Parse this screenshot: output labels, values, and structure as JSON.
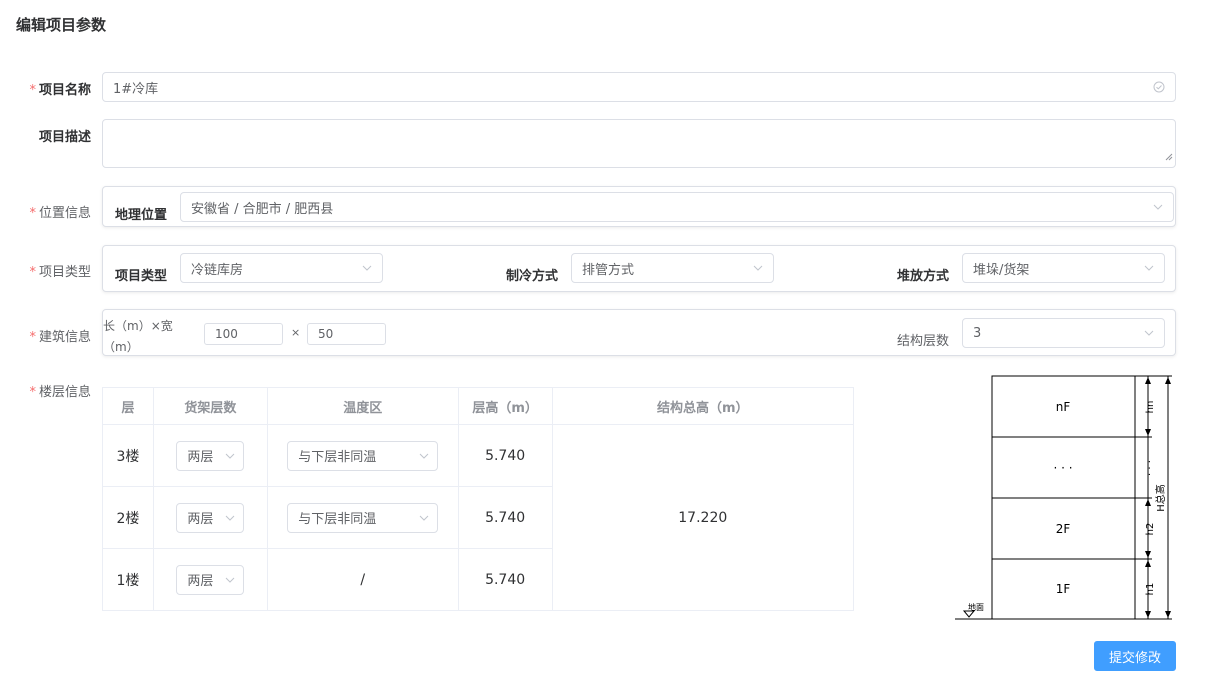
{
  "page_title": "编辑项目参数",
  "required_mark": "*",
  "fields": {
    "project_name": {
      "label": "项目名称",
      "value": "1#冷库"
    },
    "project_desc": {
      "label": "项目描述",
      "value": ""
    },
    "location": {
      "label": "位置信息",
      "inner_label": "地理位置",
      "value": "安徽省 / 合肥市 / 肥西县"
    },
    "project_type": {
      "label": "项目类型",
      "type_label": "项目类型",
      "type_value": "冷链库房",
      "cooling_label": "制冷方式",
      "cooling_value": "排管方式",
      "stacking_label": "堆放方式",
      "stacking_value": "堆垛/货架"
    },
    "building": {
      "label": "建筑信息",
      "size_label_1": "长（m）×宽",
      "size_label_2": "（m）",
      "length": "100",
      "times": "×",
      "width": "50",
      "floors_label": "结构层数",
      "floors_value": "3"
    },
    "floor_info": {
      "label": "楼层信息"
    }
  },
  "floor_table": {
    "headers": [
      "层",
      "货架层数",
      "温度区",
      "层高（m）",
      "结构总高（m）"
    ],
    "rows": [
      {
        "floor": "3楼",
        "rack": "两层",
        "temp": "与下层非同温",
        "height": "5.740"
      },
      {
        "floor": "2楼",
        "rack": "两层",
        "temp": "与下层非同温",
        "height": "5.740"
      },
      {
        "floor": "1楼",
        "rack": "两层",
        "temp": "/",
        "height": "5.740"
      }
    ],
    "total_height": "17.220"
  },
  "diagram": {
    "floors": [
      "nF",
      "· · ·",
      "2F",
      "1F"
    ],
    "dims": [
      "hn",
      "· · ·",
      "h2",
      "h1"
    ],
    "total": "H总高",
    "ground": "地面"
  },
  "submit_label": "提交修改",
  "colors": {
    "primary": "#409eff",
    "required": "#f56c6c",
    "border": "#dcdfe6"
  }
}
